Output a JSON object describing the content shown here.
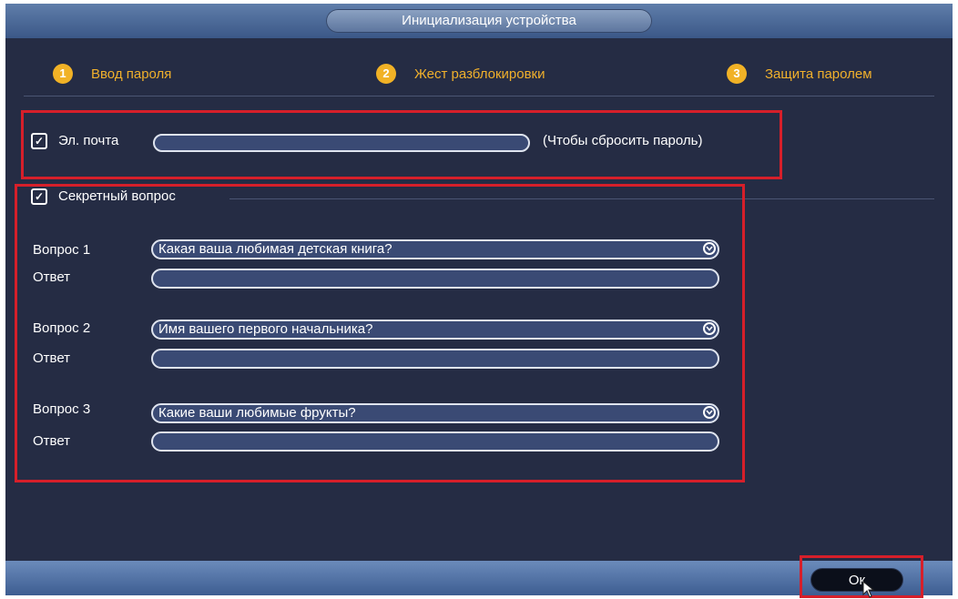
{
  "window": {
    "title": "Инициализация устройства"
  },
  "steps": [
    {
      "number": "1",
      "label": "Ввод пароля"
    },
    {
      "number": "2",
      "label": "Жест разблокировки"
    },
    {
      "number": "3",
      "label": "Защита паролем"
    }
  ],
  "email": {
    "label": "Эл. почта",
    "checked": true,
    "value": "",
    "hint": "(Чтобы сбросить пароль)"
  },
  "security": {
    "label": "Секретный вопрос",
    "checked": true,
    "questions": [
      {
        "label": "Вопрос 1",
        "value": "Какая ваша любимая детская книга?",
        "answer_label": "Ответ",
        "answer": ""
      },
      {
        "label": "Вопрос 2",
        "value": "Имя вашего первого начальника?",
        "answer_label": "Ответ",
        "answer": ""
      },
      {
        "label": "Вопрос 3",
        "value": "Какие ваши любимые фрукты?",
        "answer_label": "Ответ",
        "answer": ""
      }
    ]
  },
  "footer": {
    "ok_label": "Ок"
  },
  "colors": {
    "background": "#252c44",
    "accent": "#f0b02c",
    "highlight_box": "#d61f2a",
    "bar": "#4f6ea0"
  },
  "icons": {
    "checkbox": "check-icon",
    "dropdown": "chevron-down-icon",
    "cursor": "mouse-cursor-icon"
  }
}
